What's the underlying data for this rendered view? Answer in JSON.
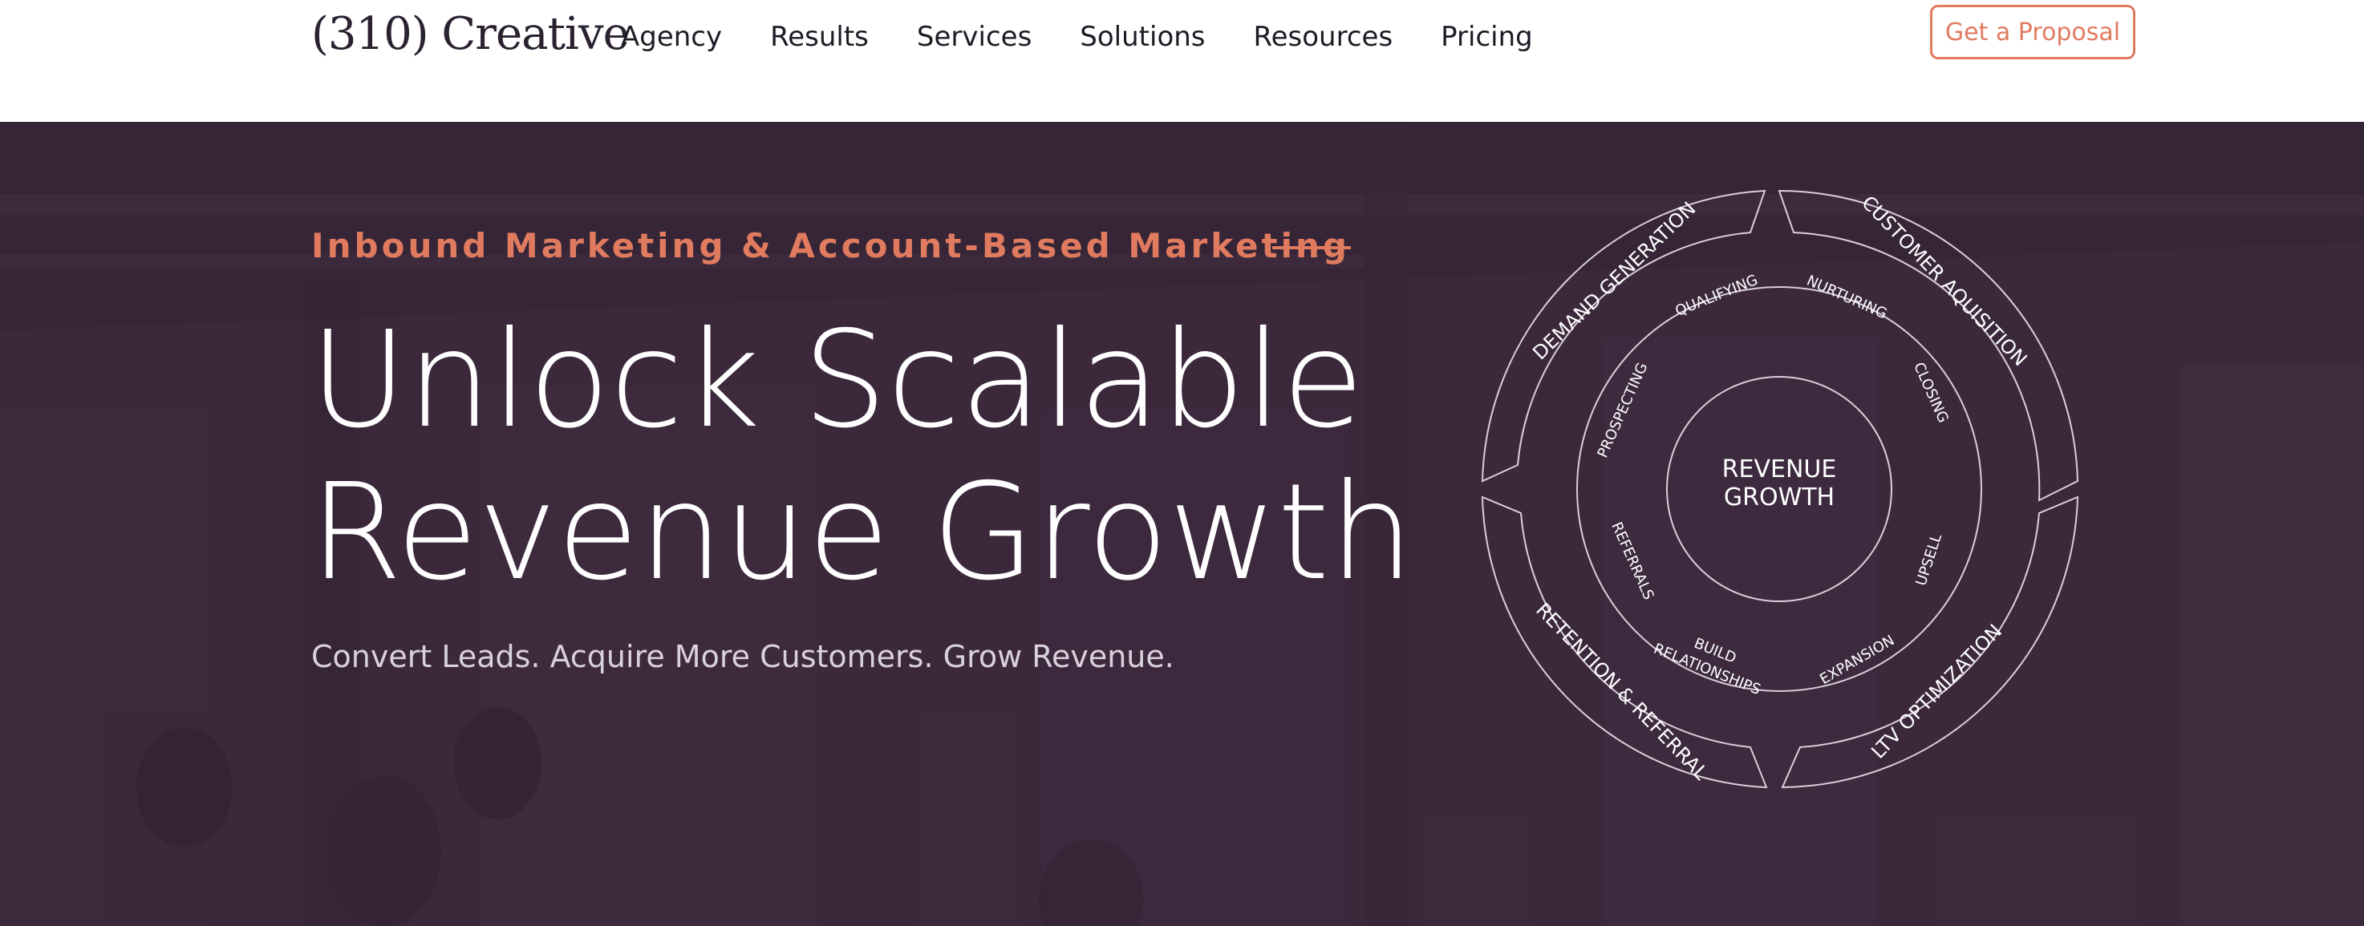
{
  "header": {
    "logo_text": "(310) Creative",
    "nav": [
      "Agency",
      "Results",
      "Services",
      "Solutions",
      "Resources",
      "Pricing"
    ],
    "cta_label": "Get a Proposal"
  },
  "hero": {
    "eyebrow": "Inbound Marketing & Account-Based Marketing",
    "headline_line1": "Unlock Scalable",
    "headline_line2": "Revenue Growth",
    "subhead": "Convert Leads. Acquire More Customers. Grow Revenue."
  },
  "wheel": {
    "center_line1": "REVENUE",
    "center_line2": "GROWTH",
    "outer": [
      "DEMAND GENERATION",
      "CUSTOMER AQUISITION",
      "LTV OPTIMIZATION",
      "RETENTION & REFERRAL"
    ],
    "inner": [
      "QUALIFYING",
      "NURTURING",
      "CLOSING",
      "UPSELL",
      "EXPANSION",
      "BUILD",
      "RELATIONSHIPS",
      "REFERRALS",
      "PROSPECTING"
    ]
  },
  "colors": {
    "accent": "#e07b5f",
    "hero_bg": "#3c2a3c",
    "text_dark": "#1f1a24"
  }
}
